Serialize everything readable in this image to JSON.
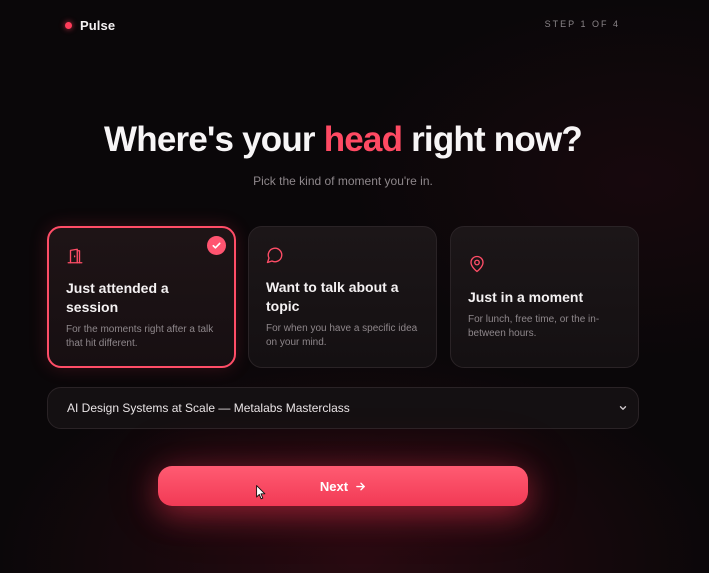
{
  "header": {
    "brand": "Pulse",
    "step": "STEP 1 OF 4"
  },
  "hero": {
    "title_before": "Where's your ",
    "title_accent": "head",
    "title_after": " right now?",
    "subtitle": "Pick the kind of moment you're in."
  },
  "options": [
    {
      "title": "Just attended a session",
      "description": "For the moments right after a talk that hit different.",
      "icon": "door-icon",
      "selected": true
    },
    {
      "title": "Want to talk about a topic",
      "description": "For when you have a specific idea on your mind.",
      "icon": "chat-bubble-icon",
      "selected": false
    },
    {
      "title": "Just in a moment",
      "description": "For lunch, free time, or the in-between hours.",
      "icon": "map-pin-icon",
      "selected": false
    }
  ],
  "session_select": {
    "value": "AI Design Systems at Scale — Metalabs Masterclass",
    "icon": "chevron-down-icon"
  },
  "next_button": {
    "label": "Next",
    "icon": "arrow-right-icon"
  },
  "colors": {
    "accent": "#ff4a63",
    "background": "#0a0709",
    "card": "#1a1416",
    "muted_text": "#8e878b"
  }
}
